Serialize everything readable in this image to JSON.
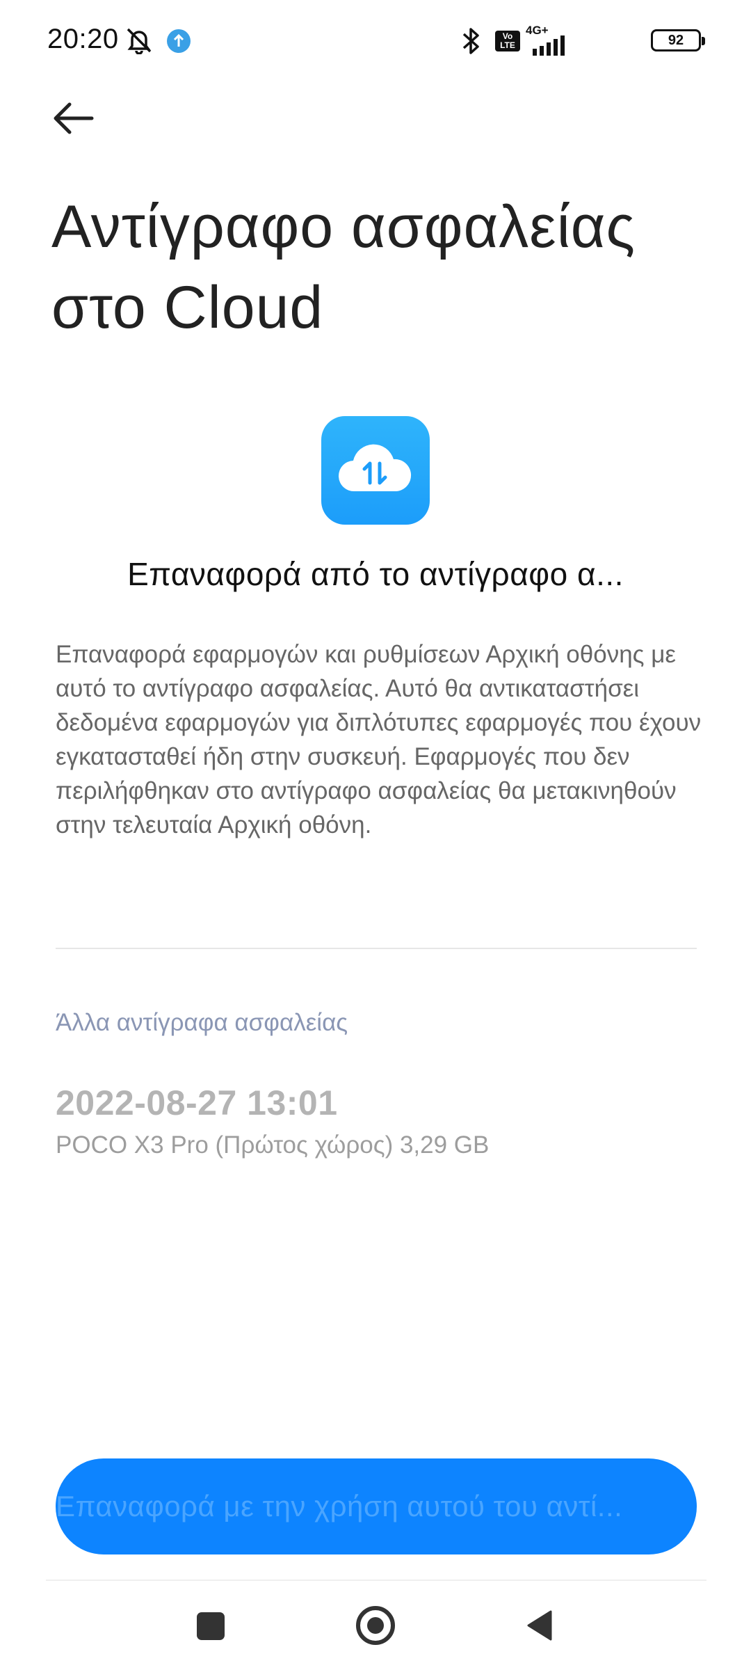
{
  "status_bar": {
    "time": "20:20",
    "network": "4G+",
    "volte": "Vo LTE",
    "battery": "92"
  },
  "page": {
    "title": "Αντίγραφο ασφαλείας στο Cloud",
    "heading": "Επαναφορά από το αντίγραφο α...",
    "description": "Επαναφορά εφαρμογών και ρυθμίσεων Αρχική οθόνης με αυτό το αντίγραφο ασφαλείας. Αυτό θα αντικαταστήσει δεδομένα εφαρμογών για διπλότυπες εφαρμογές που έχουν εγκατασταθεί ήδη στην συσκευή. Εφαρμογές που δεν περιλήφθηκαν στο αντίγραφο ασφαλείας θα μετακινηθούν στην τελευταία Αρχική οθόνη.",
    "other_backups_label": "Άλλα αντίγραφα ασφαλείας",
    "backups": [
      {
        "date": "2022-08-27 13:01",
        "meta": "POCO X3 Pro (Πρώτος χώρος) 3,29 GB"
      }
    ],
    "restore_button": "Επαναφορά με την χρήση αυτού του αντί..."
  },
  "colors": {
    "accent": "#0d84ff",
    "cloud_icon": "#1c9dfa",
    "section_label": "#8a96b4"
  },
  "icons": {
    "back": "arrow-left-icon",
    "app": "cloud-sync-icon",
    "nav_recents": "square-icon",
    "nav_home": "circle-icon",
    "nav_back": "triangle-left-icon"
  }
}
